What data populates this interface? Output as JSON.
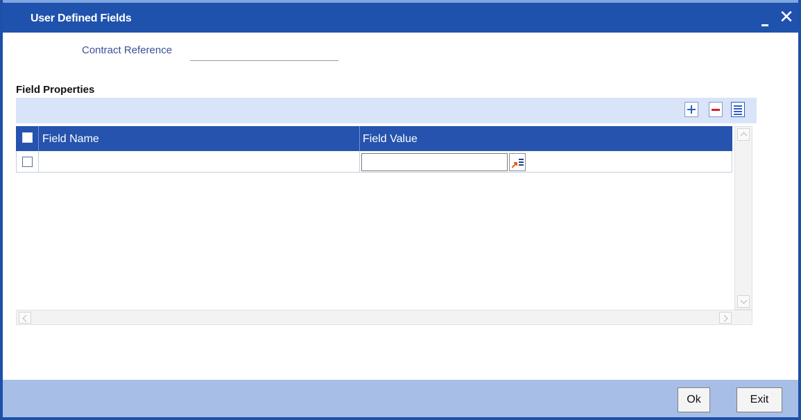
{
  "window": {
    "title": "User Defined Fields",
    "minimize_label": "_",
    "close_label": "✕"
  },
  "header": {
    "contract_reference": {
      "label": "Contract Reference",
      "value": ""
    }
  },
  "field_properties": {
    "title": "Field Properties",
    "toolbar": {
      "add_icon": "plus-icon",
      "delete_icon": "minus-icon",
      "single_view_icon": "single-record-view-icon"
    },
    "columns": [
      "Field Name",
      "Field Value"
    ],
    "rows": [
      {
        "checked": false,
        "field_name": "",
        "field_value": ""
      }
    ]
  },
  "footer": {
    "ok_label": "Ok",
    "exit_label": "Exit"
  },
  "colors": {
    "title_bar": "#1f52ad",
    "grid_header": "#2553ae",
    "toolbar_strip": "#d9e4f8",
    "footer": "#a7bfe6",
    "label_text": "#3b5098"
  }
}
